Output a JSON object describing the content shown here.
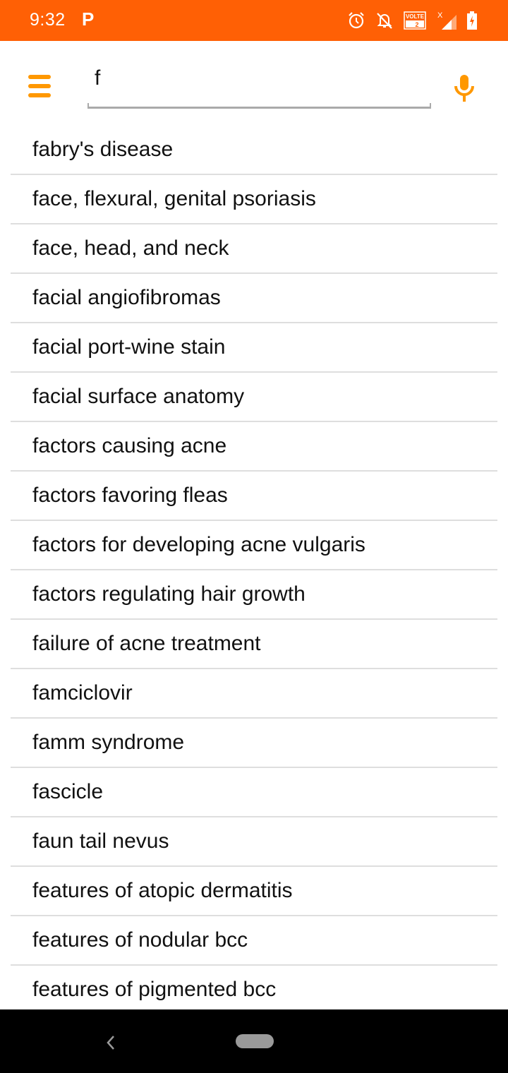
{
  "status_bar": {
    "time": "9:32",
    "notification_app": "P",
    "icons": [
      "alarm-icon",
      "bell-off-icon",
      "volte-icon",
      "signal-icon",
      "battery-charging-icon"
    ],
    "volte_label": "VOLTE",
    "sim_label": "2"
  },
  "app_bar": {
    "menu_icon": "hamburger-menu-icon",
    "search_value": "f",
    "mic_icon": "microphone-icon",
    "accent_color": "#ff9800"
  },
  "results": [
    "fabry's disease",
    "face, flexural, genital psoriasis",
    "face, head, and neck",
    "facial angiofibromas",
    "facial port-wine stain",
    "facial surface anatomy",
    "factors causing acne",
    "factors favoring fleas",
    "factors for developing acne vulgaris",
    "factors regulating hair growth",
    "failure of acne treatment",
    "famciclovir",
    "famm syndrome",
    "fascicle",
    "faun tail nevus",
    "features of atopic dermatitis",
    "features of nodular bcc",
    "features of pigmented bcc"
  ],
  "nav_bar": {
    "back_icon": "back-chevron-icon",
    "home_icon": "home-pill-icon"
  },
  "colors": {
    "status_bar": "#ff6005",
    "accent": "#ff9800",
    "divider": "#dedede"
  }
}
